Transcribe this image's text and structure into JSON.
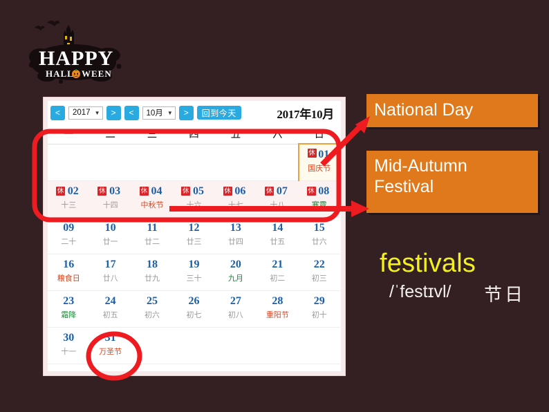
{
  "background_color": "#341f23",
  "logo": {
    "line1": "HAPPY",
    "line2a": "HALL",
    "line2b": "WEEN",
    "alt": "happy-halloween-logo"
  },
  "calendar": {
    "toolbar": {
      "prev_year_label": "<",
      "next_year_label": ">",
      "prev_month_label": "<",
      "next_month_label": ">",
      "year_value": "2017",
      "month_value": "10月",
      "caret": "▼",
      "today_button": "回到今天",
      "title": "2017年10月"
    },
    "weekday_headers": [
      "一",
      "二",
      "三",
      "四",
      "五",
      "六",
      "日"
    ],
    "rest_badge": "休",
    "accent_blue": "#29abe2",
    "day_number_color": "#1b5fa8",
    "festival_color": "#d9461e",
    "solar_term_color": "#1d8a3a",
    "rest_badge_color": "#d8252a",
    "today_border_color": "#e8a33d",
    "weeks": [
      [
        {
          "num": "",
          "lunar": ""
        },
        {
          "num": "",
          "lunar": ""
        },
        {
          "num": "",
          "lunar": ""
        },
        {
          "num": "",
          "lunar": ""
        },
        {
          "num": "",
          "lunar": ""
        },
        {
          "num": "",
          "lunar": ""
        },
        {
          "num": "01",
          "lunar": "国庆节",
          "kind": "fest",
          "rest": true,
          "today": true
        }
      ],
      [
        {
          "num": "02",
          "lunar": "十三",
          "rest": true
        },
        {
          "num": "03",
          "lunar": "十四",
          "rest": true
        },
        {
          "num": "04",
          "lunar": "中秋节",
          "kind": "fest",
          "rest": true
        },
        {
          "num": "05",
          "lunar": "十六",
          "rest": true
        },
        {
          "num": "06",
          "lunar": "十七",
          "rest": true
        },
        {
          "num": "07",
          "lunar": "十八",
          "rest": true
        },
        {
          "num": "08",
          "lunar": "寒露",
          "kind": "solar",
          "rest": true
        }
      ],
      [
        {
          "num": "09",
          "lunar": "二十"
        },
        {
          "num": "10",
          "lunar": "廿一"
        },
        {
          "num": "11",
          "lunar": "廿二"
        },
        {
          "num": "12",
          "lunar": "廿三"
        },
        {
          "num": "13",
          "lunar": "廿四"
        },
        {
          "num": "14",
          "lunar": "廿五"
        },
        {
          "num": "15",
          "lunar": "廿六"
        }
      ],
      [
        {
          "num": "16",
          "lunar": "粮食日",
          "kind": "fest"
        },
        {
          "num": "17",
          "lunar": "廿八"
        },
        {
          "num": "18",
          "lunar": "廿九"
        },
        {
          "num": "19",
          "lunar": "三十"
        },
        {
          "num": "20",
          "lunar": "九月",
          "kind": "solar"
        },
        {
          "num": "21",
          "lunar": "初二"
        },
        {
          "num": "22",
          "lunar": "初三"
        }
      ],
      [
        {
          "num": "23",
          "lunar": "霜降",
          "kind": "solar"
        },
        {
          "num": "24",
          "lunar": "初五"
        },
        {
          "num": "25",
          "lunar": "初六"
        },
        {
          "num": "26",
          "lunar": "初七"
        },
        {
          "num": "27",
          "lunar": "初八"
        },
        {
          "num": "28",
          "lunar": "重阳节",
          "kind": "fest"
        },
        {
          "num": "29",
          "lunar": "初十"
        }
      ],
      [
        {
          "num": "30",
          "lunar": "十一"
        },
        {
          "num": "31",
          "lunar": "万圣节",
          "kind": "fest"
        },
        {
          "num": "",
          "lunar": ""
        },
        {
          "num": "",
          "lunar": ""
        },
        {
          "num": "",
          "lunar": ""
        },
        {
          "num": "",
          "lunar": ""
        },
        {
          "num": "",
          "lunar": ""
        }
      ]
    ]
  },
  "annotations": {
    "color": "#ee1b20",
    "highlight_box": "red-rounded-rectangle-around-first-two-weeks",
    "arrow_national_day": "arrow-from-oct-01-to-national-day-tag",
    "arrow_mid_autumn": "arrow-from-oct-04-to-mid-autumn-festival-tag",
    "circle_halloween": "red-circle-around-oct-31"
  },
  "tags": {
    "national_day": "National Day",
    "mid_autumn": "Mid-Autumn\nFestival",
    "mid_autumn_line1": "Mid-Autumn",
    "mid_autumn_line2": "Festival",
    "color": "#e0781c"
  },
  "vocab": {
    "word": "festivals",
    "word_color": "#f2f21a",
    "phonetic": "/ˈfestɪvl/",
    "chinese": "节日"
  }
}
